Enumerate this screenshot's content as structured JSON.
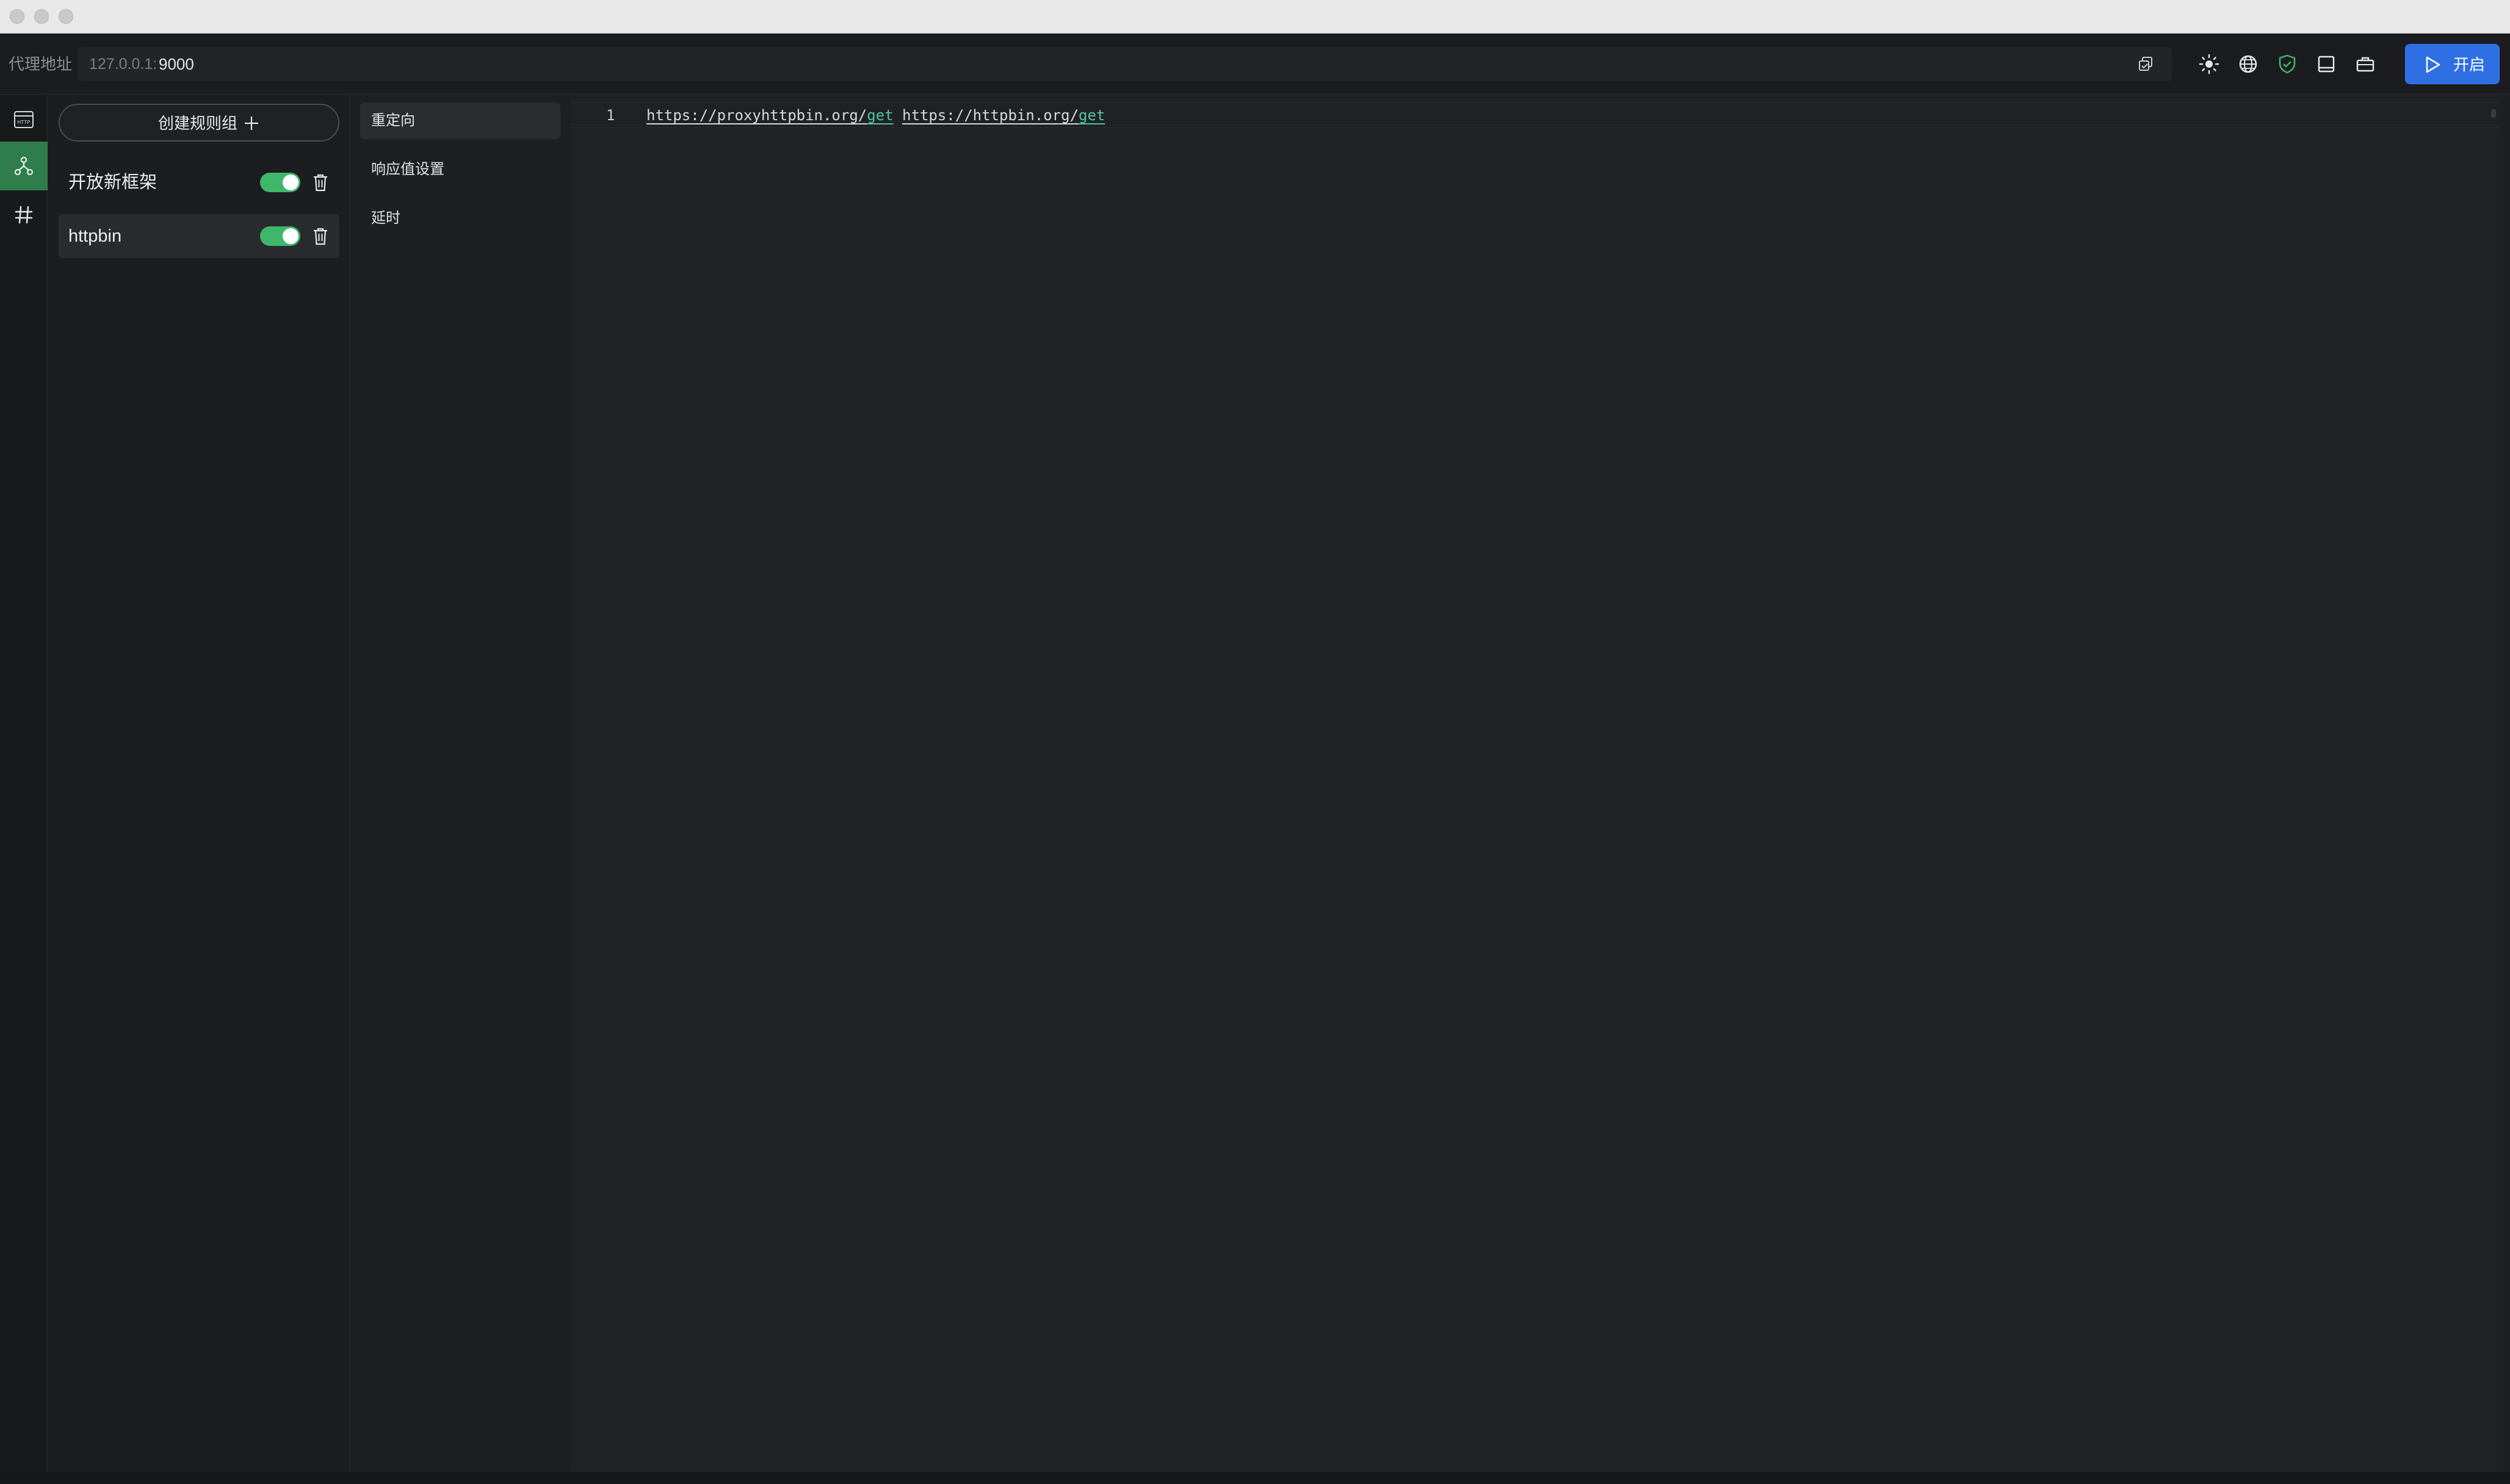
{
  "window": {
    "controls": [
      "close",
      "minimize",
      "zoom"
    ]
  },
  "toolbar": {
    "proxy_label": "代理地址",
    "proxy_host": "127.0.0.1:",
    "proxy_port": "9000",
    "icons": [
      "copy-icon",
      "sun-icon",
      "globe-icon",
      "shield-check-icon",
      "panel-icon",
      "toolbox-icon"
    ],
    "start_label": "开启",
    "start_color": "#2f6fe4"
  },
  "rail": {
    "items": [
      {
        "name": "http-icon",
        "active": false
      },
      {
        "name": "rules-icon",
        "active": true
      },
      {
        "name": "hash-icon",
        "active": false
      }
    ],
    "active_color": "#2f7d4a"
  },
  "groups": {
    "create_label": "创建规则组",
    "items": [
      {
        "name": "开放新框架",
        "enabled": true,
        "selected": false
      },
      {
        "name": "httpbin",
        "enabled": true,
        "selected": true
      }
    ],
    "toggle_color": "#3fb76b"
  },
  "rule_types": {
    "items": [
      "重定向",
      "响应值设置",
      "延时"
    ],
    "active_index": 0
  },
  "editor": {
    "line_number": "1",
    "from_base": "https://proxyhttpbin.org/",
    "from_path": "get",
    "to_base": "https://httpbin.org/",
    "to_path": "get",
    "keyword_color": "#4ec8a0"
  }
}
